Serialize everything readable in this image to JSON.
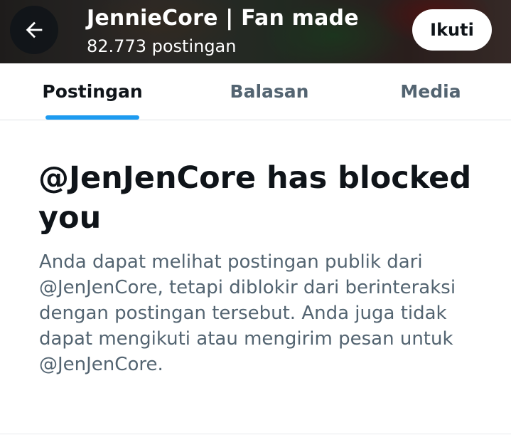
{
  "header": {
    "title": "JennieCore | Fan made",
    "post_count": "82.773 postingan",
    "back_icon": "arrow-left-icon",
    "follow_label": "Ikuti"
  },
  "tabs": [
    {
      "label": "Postingan",
      "active": true
    },
    {
      "label": "Balasan",
      "active": false
    },
    {
      "label": "Media",
      "active": false
    }
  ],
  "blocked": {
    "headline": "@JenJenCore has blocked you",
    "description": "Anda dapat melihat postingan publik dari @JenJenCore, tetapi diblokir dari berinteraksi dengan postingan tersebut. Anda juga tidak dapat mengikuti atau mengirim pesan untuk @JenJenCore."
  },
  "colors": {
    "accent": "#1d9bf0",
    "text_primary": "#0f1419",
    "text_secondary": "#536471"
  }
}
